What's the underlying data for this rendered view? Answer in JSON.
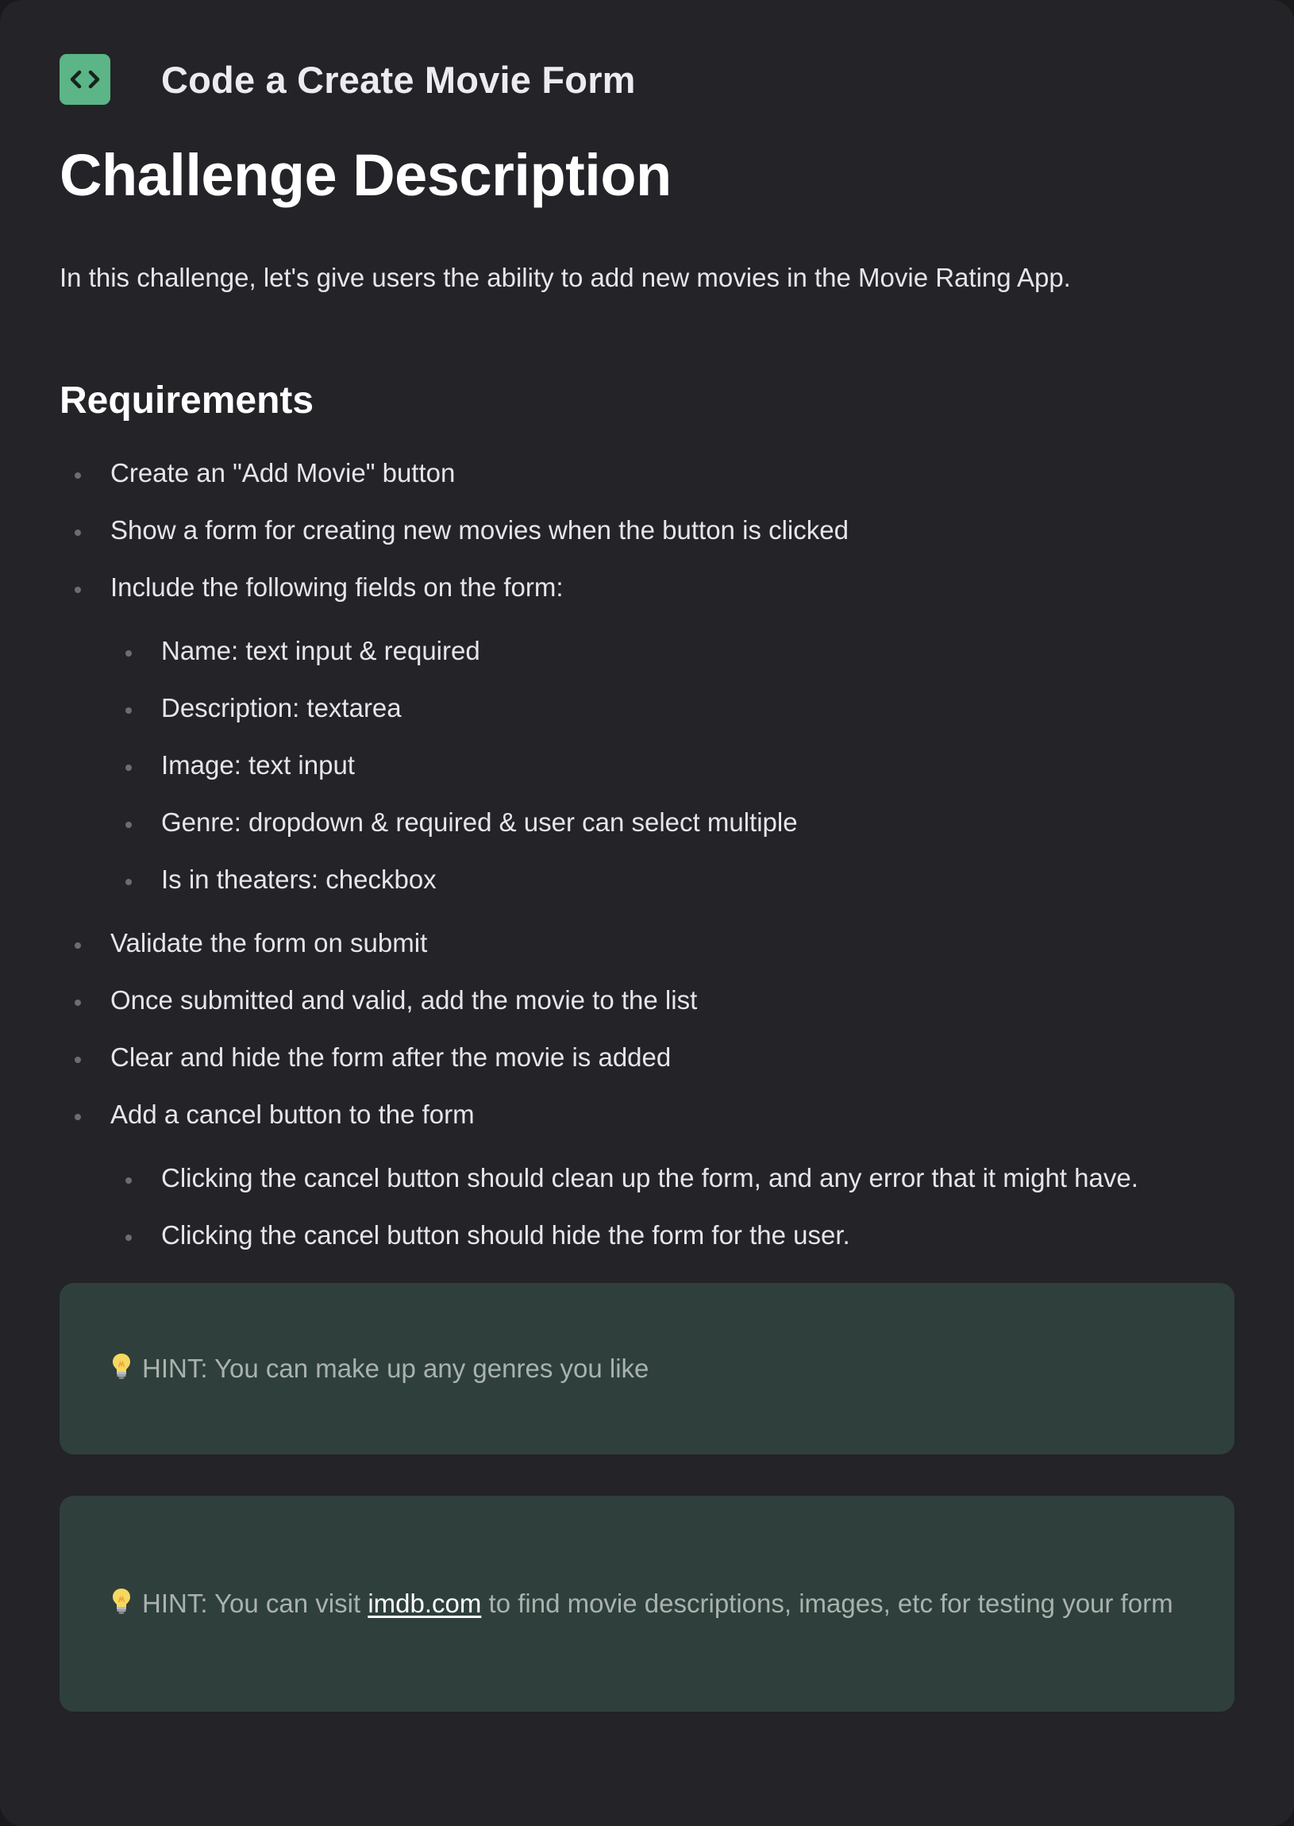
{
  "header": {
    "icon": "code-icon",
    "title": "Code a Create Movie Form"
  },
  "main": {
    "heading": "Challenge Description",
    "intro": "In this challenge, let's give users the ability to add new movies in the Movie Rating App.",
    "requirements_heading": "Requirements",
    "requirements": [
      {
        "text": "Create an \"Add Movie\" button"
      },
      {
        "text": "Show a form for creating new movies when the button is clicked"
      },
      {
        "text": "Include the following fields on the form:",
        "sub": [
          "Name: text input & required",
          "Description: textarea",
          "Image: text input",
          "Genre: dropdown & required & user can select multiple",
          "Is in theaters: checkbox"
        ]
      },
      {
        "text": "Validate the form on submit"
      },
      {
        "text": "Once submitted and valid, add the movie to the list"
      },
      {
        "text": "Clear and hide the form after the movie is added"
      },
      {
        "text": "Add a cancel button to the form",
        "sub": [
          "Clicking the cancel button should clean up the form, and any error that it might have.",
          "Clicking the cancel button should hide the form for the user."
        ]
      }
    ],
    "hints": [
      {
        "icon": "lightbulb-icon",
        "prefix": "HINT: You can make up any genres you like"
      },
      {
        "icon": "lightbulb-icon",
        "prefix": "HINT: You can visit ",
        "link": "imdb.com",
        "suffix": " to find movie descriptions, images, etc for testing your form"
      }
    ]
  },
  "colors": {
    "page_bg": "#232328",
    "icon_bg": "#5bb586",
    "hint_bg": "#2f3f3b",
    "hint_text": "#a9b2ae"
  }
}
